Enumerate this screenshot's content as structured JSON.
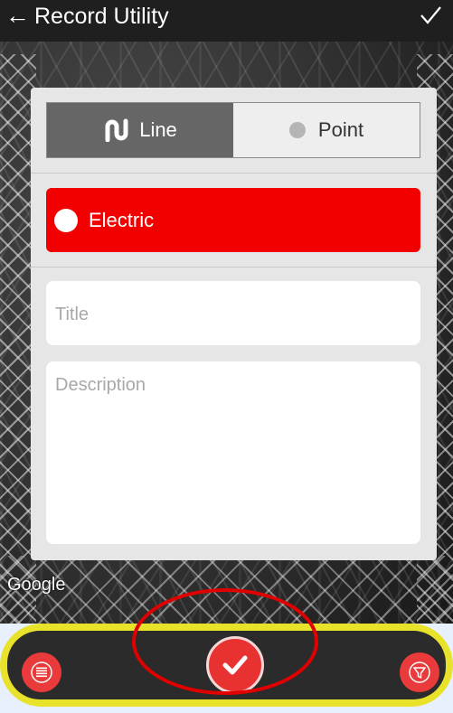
{
  "app_bar": {
    "title": "Record Utility",
    "back_icon": "arrow-left-icon",
    "confirm_icon": "check-icon"
  },
  "type_toggle": {
    "options": [
      {
        "label": "Line",
        "icon": "line-path-icon",
        "selected": true
      },
      {
        "label": "Point",
        "icon": "dot-icon",
        "selected": false
      }
    ]
  },
  "category": {
    "label": "Electric",
    "color": "#f20000"
  },
  "form": {
    "title_placeholder": "Title",
    "description_placeholder": "Description"
  },
  "map": {
    "attribution": "Google"
  },
  "bottom_bar": {
    "left_icon": "list-icon",
    "center_icon": "check-icon",
    "right_icon": "filter-icon",
    "accent": "#e83232",
    "highlight": "#e8e22b"
  }
}
